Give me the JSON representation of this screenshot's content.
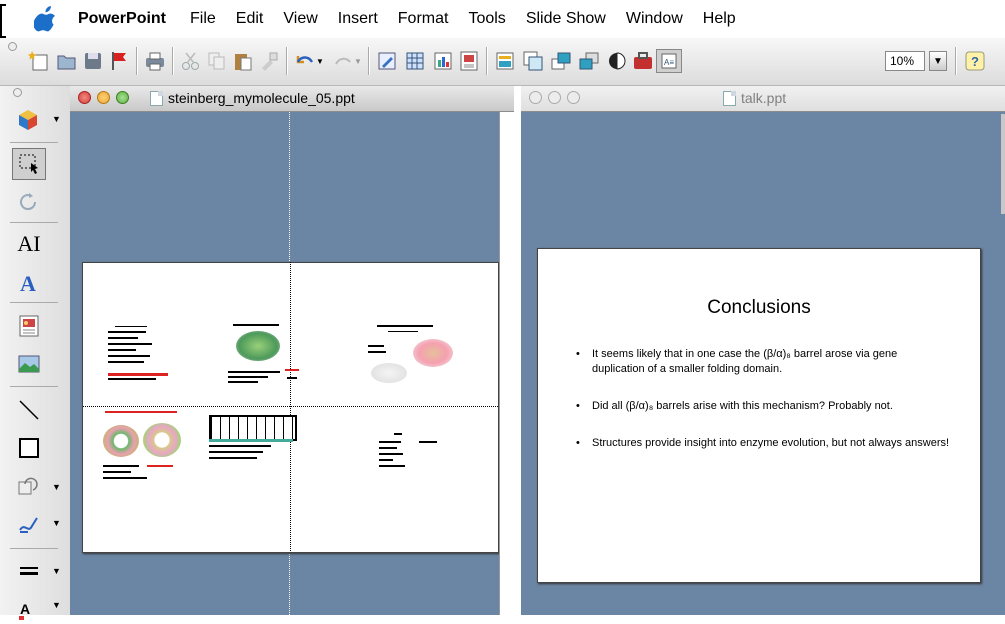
{
  "menubar": {
    "app": "PowerPoint",
    "items": [
      "File",
      "Edit",
      "View",
      "Insert",
      "Format",
      "Tools",
      "Slide Show",
      "Window",
      "Help"
    ]
  },
  "toolbar": {
    "zoom": "10%"
  },
  "windows": {
    "left": {
      "title": "steinberg_mymolecule_05.ppt"
    },
    "right": {
      "title": "talk.ppt",
      "slide": {
        "title": "Conclusions",
        "bullets": [
          "It seems likely that in one case the (β/α)₈ barrel arose via gene duplication of a smaller folding domain.",
          "Did all (β/α)₈ barrels arise with this mechanism? Probably not.",
          "Structures provide insight into enzyme evolution, but not always answers!"
        ]
      }
    }
  },
  "colors": {
    "canvas": "#6b86a4",
    "close": "#d6403a",
    "minimize": "#e8a93b",
    "zoom": "#5fb04a"
  }
}
